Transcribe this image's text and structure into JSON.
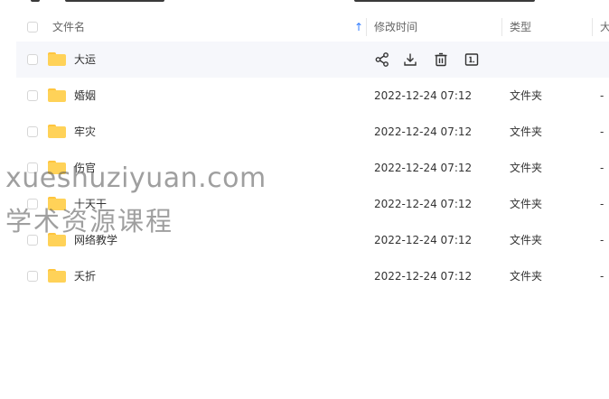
{
  "header": {
    "name_label": "文件名",
    "time_label": "修改时间",
    "type_label": "类型",
    "size_label": "大"
  },
  "files": [
    {
      "name": "大运",
      "time": "",
      "type": "",
      "size": "",
      "hover": true
    },
    {
      "name": "婚姻",
      "time": "2022-12-24 07:12",
      "type": "文件夹",
      "size": "-"
    },
    {
      "name": "牢灾",
      "time": "2022-12-24 07:12",
      "type": "文件夹",
      "size": "-"
    },
    {
      "name": "伤官",
      "time": "2022-12-24 07:12",
      "type": "文件夹",
      "size": "-"
    },
    {
      "name": "十天干",
      "time": "2022-12-24 07:12",
      "type": "文件夹",
      "size": "-"
    },
    {
      "name": "网络教学",
      "time": "2022-12-24 07:12",
      "type": "文件夹",
      "size": "-"
    },
    {
      "name": "夭折",
      "time": "2022-12-24 07:12",
      "type": "文件夹",
      "size": "-"
    }
  ],
  "row_actions": [
    "share-icon",
    "download-icon",
    "delete-icon",
    "rename-icon"
  ],
  "watermark": {
    "line1": "xueshuziyuan.com",
    "line2": "学术资源课程"
  },
  "colors": {
    "accent": "#2f7bff",
    "folder": "#ffd258",
    "hover_row": "#f6f7fb"
  }
}
